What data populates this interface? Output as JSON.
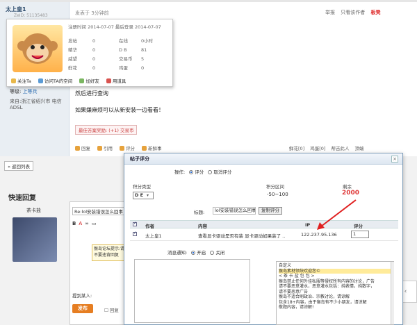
{
  "post": {
    "username": "太上皇1",
    "uid": "ZeID: 51135483",
    "posted": "发表于 3分钟前",
    "top_links": [
      "举报",
      "只看该作者"
    ],
    "top_link_bold": "板凳",
    "level_label": "等级:",
    "level_value": "上等兵",
    "from": "来自:浙江省绍兴市 电信ADSL",
    "text1": "然后进行查询",
    "text2": "如果嫌麻烦可以从新安装一边看看！",
    "rating": "最佳答案奖励: (+1) 交易币",
    "actions": [
      "回复",
      "引用",
      "评分",
      "新鲜事"
    ],
    "actions_right": [
      "鲜花[0]",
      "鸡蛋[0]",
      "帮吉此人",
      "顶端"
    ]
  },
  "card": {
    "header": "注册时间 2014-07-07 最后登录 2014-07-07",
    "stats": [
      [
        "发帖",
        "0",
        "在线",
        "0小时"
      ],
      [
        "精华",
        "0",
        "D B",
        "81"
      ],
      [
        "威望",
        "0",
        "交易币",
        "5"
      ],
      [
        "鲜花",
        "0",
        "鸡蛋",
        "0"
      ]
    ],
    "follow": "关注Ta",
    "links": [
      "访问TA的空间",
      "加好友",
      "用道具"
    ]
  },
  "nav": {
    "back": "« 返回列表"
  },
  "quick_reply": {
    "title": "快速回复",
    "user": "茶卡盐",
    "subject": "Re:lol安装错误怎么回事",
    "tools": [
      "B",
      "A",
      "∞",
      "▭"
    ],
    "tip": "猴岛论坛提示:请不要违背回复",
    "mention": "提到某人:",
    "submit": "发布",
    "check": "回复"
  },
  "dialog": {
    "title": "帖子评分",
    "close": "×",
    "op_label": "操作:",
    "op_options": [
      "评分",
      "取消评分"
    ],
    "type_label": "积分类型",
    "range_label": "积分区间",
    "remain_label": "剩余",
    "type_value": "D E",
    "range_value": "-50~100",
    "remain_value": "2000",
    "title_label": "标题:",
    "title_value": "lol安装错误怎么回事",
    "copy_btn": "复制评分",
    "columns": [
      "作者",
      "内容",
      "IP",
      "评分"
    ],
    "row": {
      "author": "太上皇1",
      "content": "查看显卡驱动是否有装 显卡驱动如果装了 ..",
      "ip": "122.237.95.136",
      "score": "1"
    },
    "notify_label": "消息通知:",
    "notify_options": [
      "开启",
      "关闭"
    ],
    "reasons_header": "自定义",
    "reasons": [
      "猴岛素材领块欢迎您©",
      "< 茶 卡 盐 包 包 >",
      "猴岛禁止任何外挂私服等侵权所有内容的讨论，广告",
      "请不要恶意灌水，恶意灌水包括：纯表情，纯数字，",
      "请不要恶意广告",
      "猴岛不适合刷政治、宗教讨论，请谅解",
      "包含18+内容，由于猴岛有不少小朋友，请谅解",
      "敬题内容，请谅解!"
    ]
  },
  "colors": {
    "accent_red": "#e03c3c",
    "link_blue": "#2b6cb0",
    "dialog_border": "#7f9db9"
  }
}
